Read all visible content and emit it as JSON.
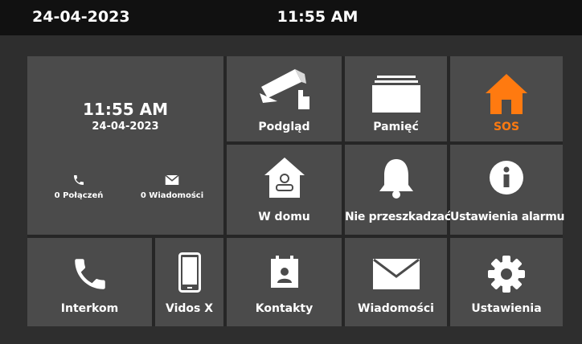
{
  "status_bar": {
    "date": "24-04-2023",
    "time": "11:55 AM"
  },
  "clock": {
    "time": "11:55 AM",
    "date": "24-04-2023",
    "calls": "0 Połączeń",
    "messages": "0 Wiadomości"
  },
  "tiles": {
    "preview": "Podgląd",
    "memory": "Pamięć",
    "sos": "SOS",
    "home": "W domu",
    "dnd": "Nie przeszkadzać",
    "alarm_settings": "Ustawienia alarmu",
    "intercom": "Interkom",
    "vidos": "Vidos X",
    "contacts": "Kontakty",
    "messages": "Wiadomości",
    "settings": "Ustawienia"
  },
  "colors": {
    "accent": "#ff7a10",
    "tile": "#4b4b4b",
    "bar": "#111111"
  },
  "icons": {
    "preview": "cctv-camera-icon",
    "memory": "folder-stack-icon",
    "sos": "house-icon",
    "home": "house-person-icon",
    "dnd": "bell-icon",
    "alarm_settings": "info-icon",
    "intercom": "phone-handset-icon",
    "vidos": "smartphone-icon",
    "contacts": "contact-card-icon",
    "messages": "envelope-icon",
    "settings": "gear-icon"
  }
}
